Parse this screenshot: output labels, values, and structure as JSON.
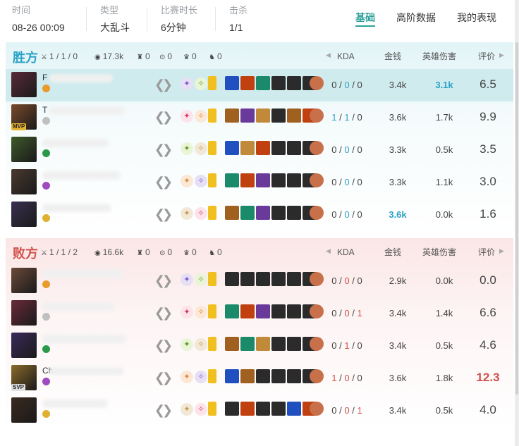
{
  "header": {
    "time_label": "时间",
    "time_value": "08-26 00:09",
    "type_label": "类型",
    "type_value": "大乱斗",
    "duration_label": "比赛时长",
    "duration_value": "6分钟",
    "kills_label": "击杀",
    "kills_value": "1/1",
    "tabs": [
      "基础",
      "高阶数据",
      "我的表现"
    ],
    "active_tab": 0
  },
  "columns": {
    "kda": "KDA",
    "gold": "金钱",
    "damage": "英雄伤害",
    "score": "评价"
  },
  "teams": [
    {
      "name": "胜方",
      "stats": {
        "kda": "1 / 1 / 0",
        "gold": "17.3k",
        "towers": "0",
        "dragons": "0",
        "barons": "0",
        "heralds": "0"
      },
      "players": [
        {
          "name": "F",
          "kda": [
            "0",
            "0",
            "0"
          ],
          "gold": "3.4k",
          "damage": "3.1k",
          "score": "6.5",
          "avatar_color": "#5a2a3a",
          "badge": ""
        },
        {
          "name": "T",
          "kda": [
            "1",
            "1",
            "0"
          ],
          "gold": "3.6k",
          "damage": "1.7k",
          "score": "9.9",
          "avatar_color": "#7a4a2a",
          "badge": "MVP"
        },
        {
          "name": "",
          "kda": [
            "0",
            "0",
            "0"
          ],
          "gold": "3.3k",
          "damage": "0.5k",
          "score": "3.5",
          "avatar_color": "#3e5a2a",
          "badge": ""
        },
        {
          "name": "",
          "kda": [
            "0",
            "0",
            "0"
          ],
          "gold": "3.3k",
          "damage": "1.1k",
          "score": "3.0",
          "avatar_color": "#4a3a30",
          "badge": ""
        },
        {
          "name": "",
          "kda": [
            "0",
            "0",
            "0"
          ],
          "gold": "3.6k",
          "damage": "0.0k",
          "score": "1.6",
          "avatar_color": "#3a3050",
          "badge": ""
        }
      ]
    },
    {
      "name": "败方",
      "stats": {
        "kda": "1 / 1 / 2",
        "gold": "16.6k",
        "towers": "0",
        "dragons": "0",
        "barons": "0",
        "heralds": "0"
      },
      "players": [
        {
          "name": "",
          "kda": [
            "0",
            "0",
            "0"
          ],
          "gold": "2.9k",
          "damage": "0.0k",
          "score": "0.0",
          "avatar_color": "#6a4a3a",
          "badge": ""
        },
        {
          "name": "",
          "kda": [
            "0",
            "0",
            "1"
          ],
          "gold": "3.4k",
          "damage": "1.4k",
          "score": "6.6",
          "avatar_color": "#6a2a3a",
          "badge": ""
        },
        {
          "name": "",
          "kda": [
            "0",
            "1",
            "0"
          ],
          "gold": "3.4k",
          "damage": "0.5k",
          "score": "4.6",
          "avatar_color": "#3a2a5a",
          "badge": ""
        },
        {
          "name": "Ch",
          "kda": [
            "1",
            "0",
            "0"
          ],
          "gold": "3.6k",
          "damage": "1.8k",
          "score": "12.3",
          "avatar_color": "#8a6a2a",
          "badge": "SVP"
        },
        {
          "name": "",
          "kda": [
            "0",
            "0",
            "1"
          ],
          "gold": "3.4k",
          "damage": "0.5k",
          "score": "4.0",
          "avatar_color": "#3a2a20",
          "badge": ""
        }
      ]
    }
  ],
  "icons": {
    "kill": "crossed-swords-icon",
    "gold": "coins-icon",
    "tower": "tower-icon",
    "dragon": "dragon-icon",
    "baron": "baron-icon",
    "herald": "herald-icon"
  }
}
